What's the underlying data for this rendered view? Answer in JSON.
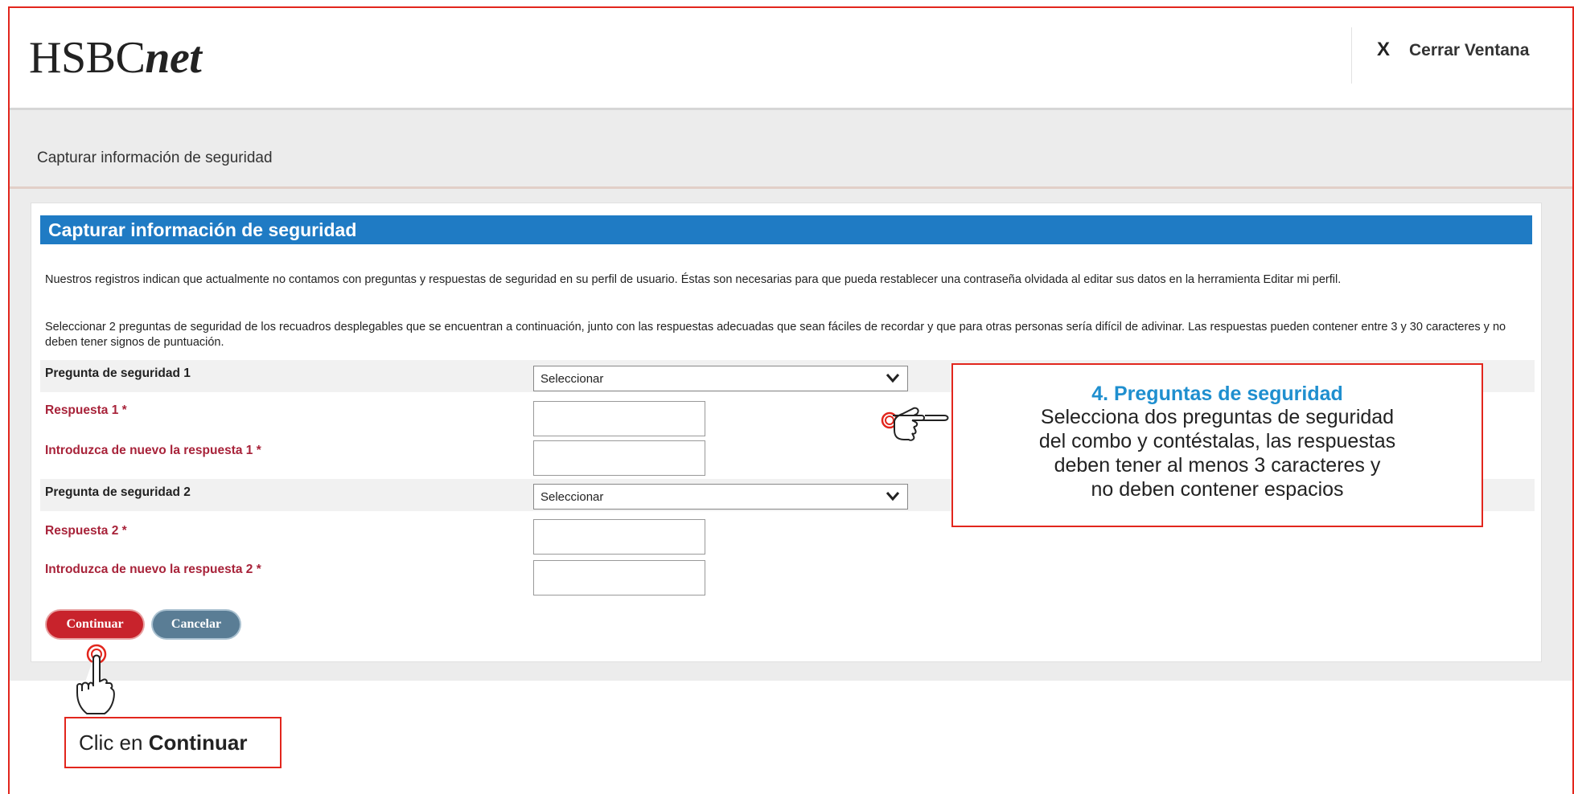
{
  "header": {
    "logo_prefix": "HSBC",
    "logo_suffix": "net",
    "close_icon": "X",
    "close_label": "Cerrar Ventana"
  },
  "breadcrumb": "Capturar información de seguridad",
  "panel": {
    "title": "Capturar información de seguridad",
    "intro_1": "Nuestros registros indican que actualmente no contamos con preguntas y respuestas de seguridad en su perfil de usuario. Éstas son necesarias para que pueda restablecer una contraseña olvidada al editar sus datos en la herramienta Editar mi perfil.",
    "intro_2": "Seleccionar 2 preguntas de seguridad de los recuadros desplegables que se encuentran a continuación, junto con las respuestas adecuadas que sean fáciles de recordar y que para otras personas sería difícil de adivinar. Las respuestas pueden contener entre 3 y 30 caracteres y no deben tener signos de puntuación."
  },
  "form": {
    "q1_label": "Pregunta de seguridad 1",
    "q1_value": "Seleccionar",
    "a1_label": "Respuesta 1 *",
    "a1_confirm_label": "Introduzca de nuevo la respuesta 1 *",
    "q2_label": "Pregunta de seguridad 2",
    "q2_value": "Seleccionar",
    "a2_label": "Respuesta 2 *",
    "a2_confirm_label": "Introduzca de nuevo la respuesta 2 *"
  },
  "buttons": {
    "continue": "Continuar",
    "cancel": "Cancelar"
  },
  "callout": {
    "title": "4. Preguntas de seguridad",
    "line_1": "Selecciona dos preguntas de seguridad",
    "line_2": "del combo y contéstalas, las respuestas",
    "line_3": "deben tener al menos 3 caracteres y",
    "line_4": "no deben contener espacios"
  },
  "hint": {
    "prefix": "Clic en ",
    "action": "Continuar"
  },
  "icons": {
    "pointer_hand": "pointer-hand-icon",
    "tap_hand": "tap-hand-icon",
    "dropdown": "chevron-down-icon"
  },
  "colors": {
    "accent_red": "#e2261d",
    "title_blue": "#1f7bc4",
    "label_red": "#a8233a",
    "callout_blue": "#1f8fcf"
  }
}
